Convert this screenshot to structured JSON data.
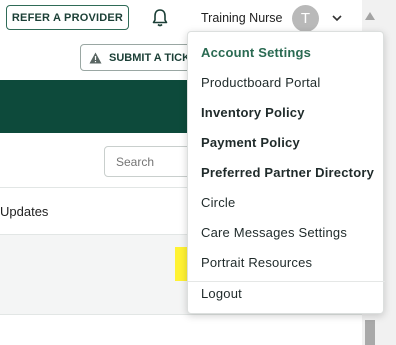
{
  "header": {
    "refer_button": "REFER A PROVIDER",
    "user_name": "Training Nurse",
    "avatar_initial": "T",
    "icons": {
      "bell": "bell-icon",
      "chevron": "chevron-down-icon"
    }
  },
  "toolbar": {
    "submit_ticket_label": "SUBMIT A TICKET"
  },
  "search": {
    "placeholder": "Search"
  },
  "content": {
    "tab_label": "Updates"
  },
  "menu": {
    "items": [
      {
        "label": "Account Settings"
      },
      {
        "label": "Productboard Portal"
      },
      {
        "label": "Inventory Policy"
      },
      {
        "label": "Payment Policy"
      },
      {
        "label": "Preferred Partner Directory"
      },
      {
        "label": "Circle"
      },
      {
        "label": "Care Messages Settings"
      },
      {
        "label": "Portrait Resources"
      }
    ],
    "logout": "Logout",
    "highlighted_item": "Portrait Resources"
  },
  "colors": {
    "brand_dark_green": "#0d4a3b",
    "accent_green": "#2a6a52",
    "highlight_yellow": "#fff233",
    "avatar_grey": "#b9b9b9"
  }
}
